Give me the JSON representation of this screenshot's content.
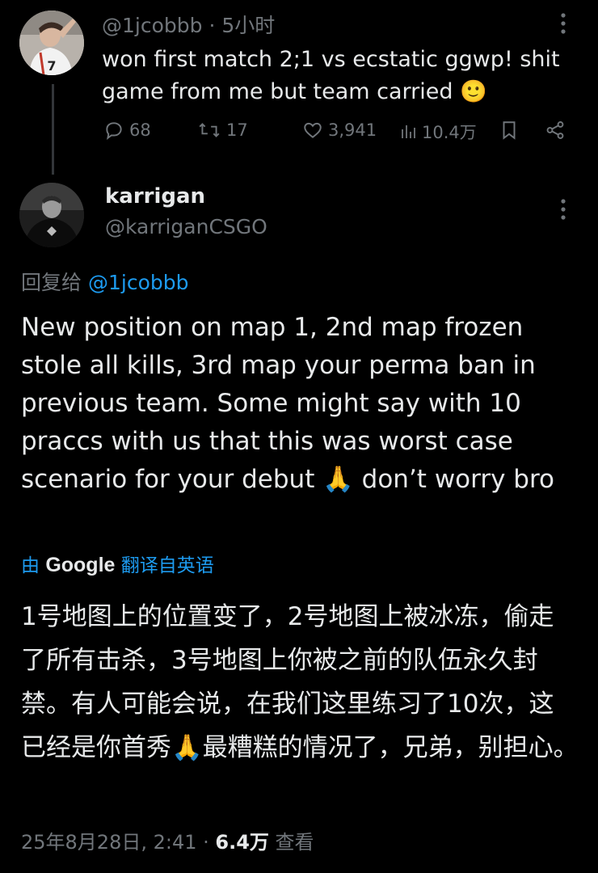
{
  "parent_tweet": {
    "handle": "@1jcobbb",
    "sep": " · ",
    "time": "5小时",
    "text": "won first match 2;1 vs ecstatic ggwp! shit game from me but team carried 🙂",
    "actions": {
      "replies": "68",
      "reposts": "17",
      "likes": "3,941",
      "views": "10.4万"
    }
  },
  "reply_tweet": {
    "name": "karrigan",
    "handle": "@karriganCSGO",
    "reply_to_label": "回复给",
    "reply_to_handle": "@1jcobbb",
    "text": "New position on map 1, 2nd map frozen stole all kills, 3rd map your perma ban in previous team. Some might say with 10 praccs with us that this was worst case scenario for your debut 🙏 don’t worry bro",
    "translated_by_prefix": "由",
    "translated_by_brand": "Google",
    "translated_by_suffix": "翻译自英语",
    "translated_text": "1号地图上的位置变了，2号地图上被冰冻，偷走了所有击杀，3号地图上你被之前的队伍永久封禁。有人可能会说，在我们这里练习了10次，这已经是你首秀🙏最糟糕的情况了，兄弟，别担心。",
    "date": "25年8月28日, 2:41",
    "sep": " · ",
    "views": "6.4万",
    "views_label": " 查看"
  },
  "colors": {
    "background": "#000000",
    "text": "#e7e9ea",
    "secondary": "#71767b",
    "link": "#1d9bf0"
  }
}
